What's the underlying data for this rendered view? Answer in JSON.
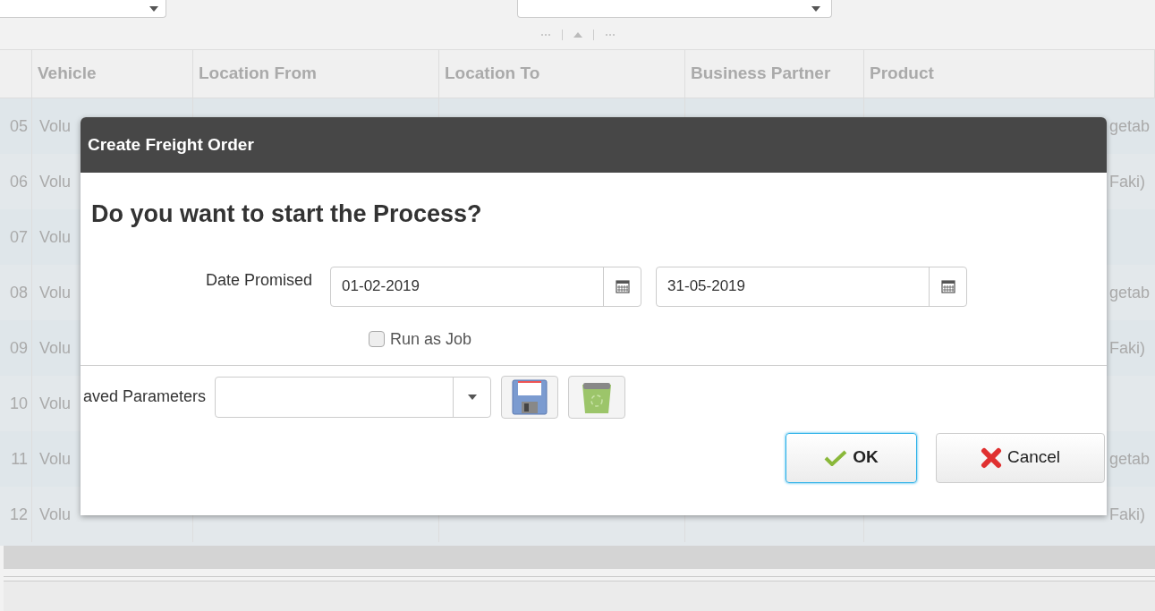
{
  "table": {
    "columns": [
      {
        "label": "Vehicle"
      },
      {
        "label": "Location From"
      },
      {
        "label": "Location To"
      },
      {
        "label": "Business Partner"
      },
      {
        "label": "Product"
      }
    ],
    "rows": [
      {
        "number": "05",
        "vehicle": "Volu",
        "product": "getab"
      },
      {
        "number": "06",
        "vehicle": "Volu",
        "product": "Faki)"
      },
      {
        "number": "07",
        "vehicle": "Volu"
      },
      {
        "number": "08",
        "vehicle": "Volu",
        "product": "getab"
      },
      {
        "number": "09",
        "vehicle": "Volu",
        "product": "Faki)"
      },
      {
        "number": "10",
        "vehicle": "Volu"
      },
      {
        "number": "11",
        "vehicle": "Volu",
        "product": "getab"
      },
      {
        "number": "12",
        "vehicle": "Volu",
        "product": "Faki)"
      }
    ]
  },
  "dialog": {
    "title": "Create Freight Order",
    "question": "Do you want to start the Process?",
    "date_label": "Date Promised",
    "date_from": "01-02-2019",
    "date_to": "31-05-2019",
    "run_as_job": {
      "label": "Run as Job",
      "checked": false
    },
    "saved_parameters": {
      "label": "aved Parameters"
    },
    "buttons": [
      {
        "kind": "ok",
        "label": "OK",
        "focused": true
      },
      {
        "kind": "cancel",
        "label": "Cancel",
        "focused": false
      }
    ]
  }
}
